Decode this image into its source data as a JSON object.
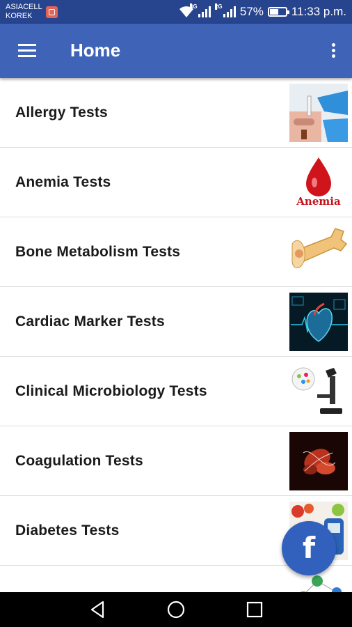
{
  "status_bar": {
    "carrier_line1": "ASIACELL",
    "carrier_line2": "KOREK",
    "network_tag_1": "3G",
    "network_tag_2": "2G",
    "battery": "57%",
    "time": "11:33 p.m.",
    "icons": [
      "notification-icon",
      "wifi-icon",
      "signal-icon",
      "signal-icon",
      "battery-icon"
    ]
  },
  "app_bar": {
    "title": "Home",
    "menu_icon": "hamburger-menu-icon",
    "overflow_icon": "more-vert-icon"
  },
  "tests": [
    {
      "label": "Allergy Tests",
      "thumbnail": "allergy-test-image"
    },
    {
      "label": "Anemia Tests",
      "thumbnail": "anemia-blood-drop-image",
      "thumbnail_text": "Anemia"
    },
    {
      "label": "Bone Metabolism Tests",
      "thumbnail": "bone-image"
    },
    {
      "label": "Cardiac Marker Tests",
      "thumbnail": "heart-image"
    },
    {
      "label": "Clinical Microbiology Tests",
      "thumbnail": "microscope-image"
    },
    {
      "label": "Coagulation Tests",
      "thumbnail": "blood-cells-image"
    },
    {
      "label": "Diabetes Tests",
      "thumbnail": "glucometer-image"
    },
    {
      "label": "",
      "thumbnail": "molecule-image"
    }
  ],
  "fab": {
    "label": "f",
    "icon": "facebook-icon"
  },
  "nav_bar": {
    "icons": [
      "back-icon",
      "home-icon",
      "recents-icon"
    ]
  },
  "colors": {
    "status_bar": "#27448f",
    "app_bar": "#3f63b6",
    "fab": "#3160bd"
  }
}
